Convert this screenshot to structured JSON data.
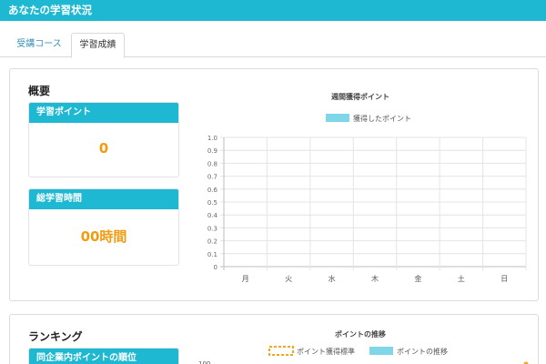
{
  "header": {
    "title": "あなたの学習状況"
  },
  "tabs": [
    {
      "label": "受講コース",
      "active": false
    },
    {
      "label": "学習成績",
      "active": true
    }
  ],
  "overview": {
    "title": "概要",
    "points_card": {
      "label": "学習ポイント",
      "value": "0"
    },
    "time_card": {
      "label": "総学習時間",
      "value": "00時間"
    }
  },
  "weekly_chart": {
    "title": "週間獲得ポイント",
    "legend": "獲得したポイント"
  },
  "ranking": {
    "title": "ランキング",
    "card_label": "同企業内ポイントの順位",
    "chart_title": "ポイントの推移",
    "legend_standard": "ポイント獲得標準",
    "legend_trend": "ポイントの推移",
    "y_top_label": "100"
  },
  "colors": {
    "accent": "#1fb8d3",
    "value_orange": "#f39b10",
    "legend_blue": "#7fd6e8",
    "legend_orange": "#f7a51c"
  },
  "chart_data": [
    {
      "type": "bar",
      "title": "週間獲得ポイント",
      "categories": [
        "月",
        "火",
        "水",
        "木",
        "金",
        "土",
        "日"
      ],
      "series": [
        {
          "name": "獲得したポイント",
          "values": [
            0,
            0,
            0,
            0,
            0,
            0,
            0
          ]
        }
      ],
      "yticks": [
        "0",
        "0.1",
        "0.2",
        "0.3",
        "0.4",
        "0.5",
        "0.6",
        "0.7",
        "0.8",
        "0.9",
        "1.0"
      ],
      "ylim": [
        0,
        1
      ],
      "grid": true,
      "legend_position": "top"
    }
  ]
}
